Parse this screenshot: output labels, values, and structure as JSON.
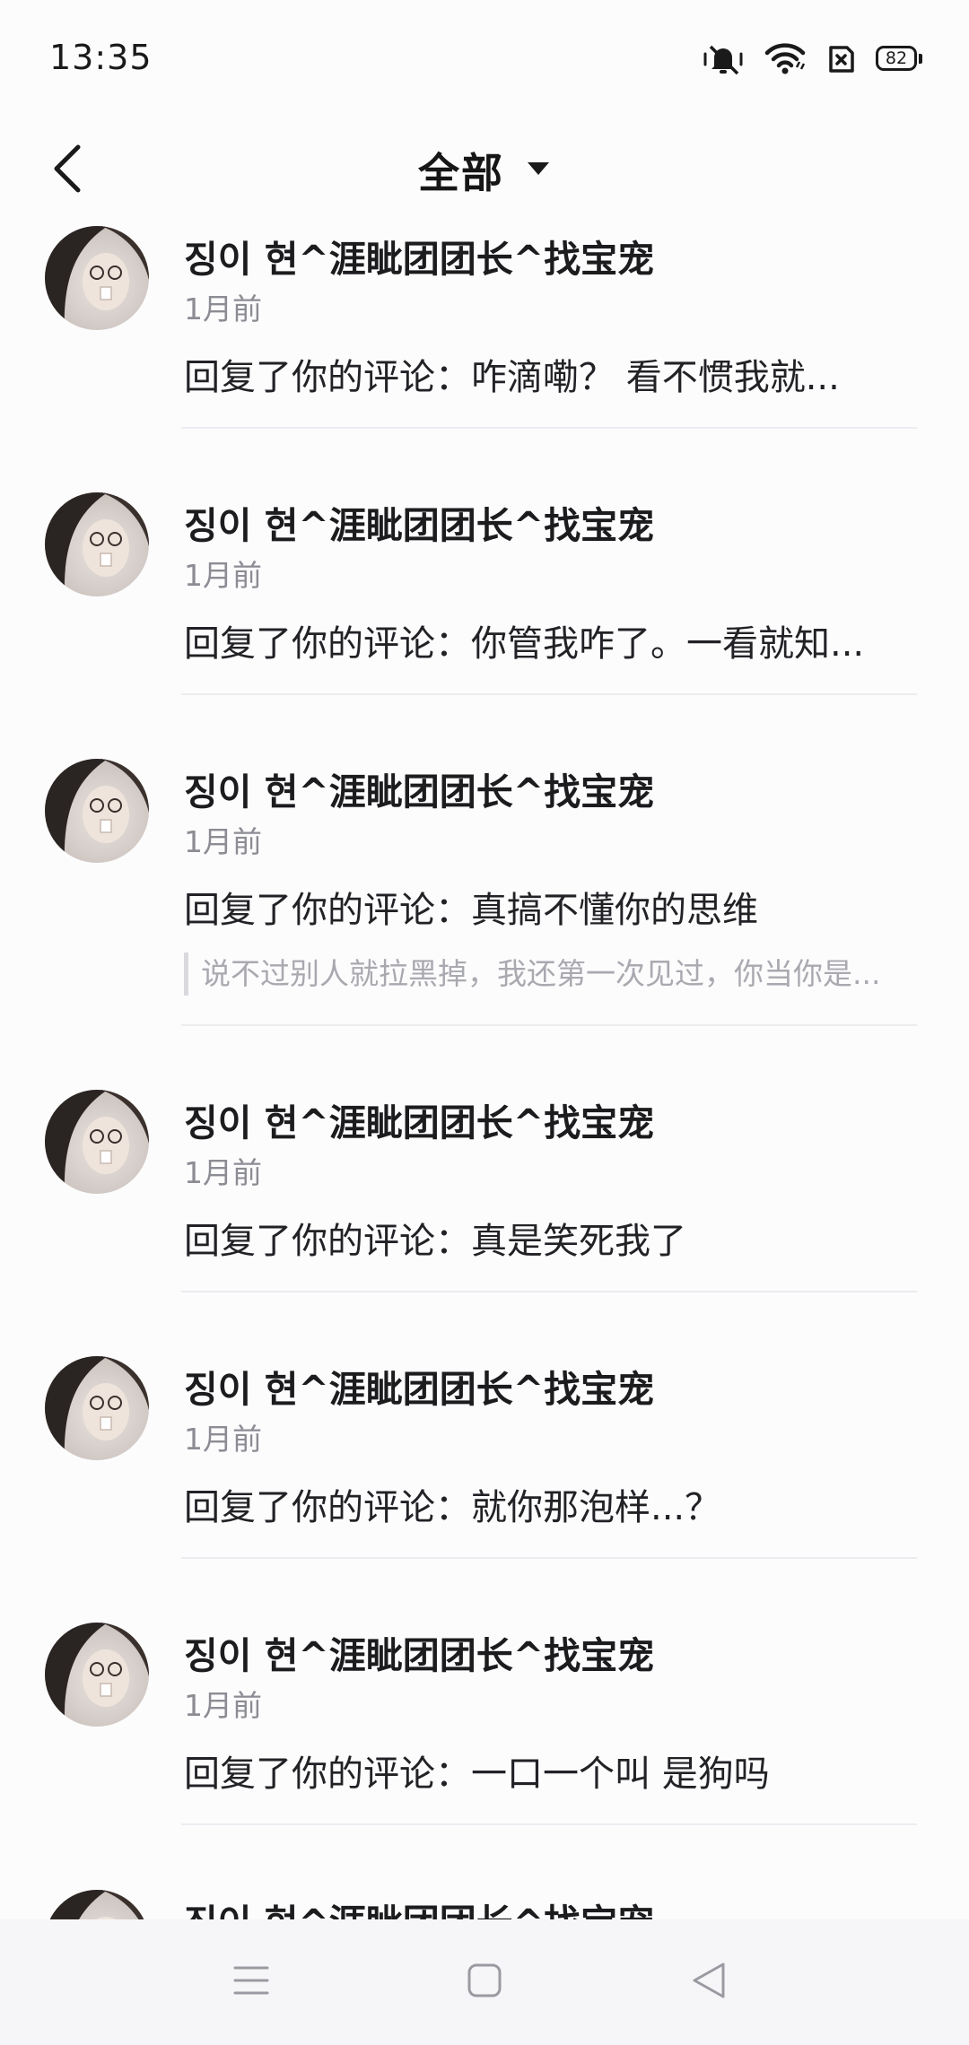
{
  "status_bar": {
    "time": "13:35",
    "battery_level": "82",
    "icons": [
      "mute-vibrate-icon",
      "wifi-icon",
      "sim-off-icon",
      "battery-icon"
    ]
  },
  "header": {
    "title": "全部",
    "back_icon": "chevron-left-icon",
    "dropdown_icon": "caret-down-icon"
  },
  "notifications": [
    {
      "username": "징이 현^涯眦团团长^找宝宠",
      "time": "1月前",
      "reply": "回复了你的评论：咋滴嘞？ 看不惯我就..."
    },
    {
      "username": "징이 현^涯眦团团长^找宝宠",
      "time": "1月前",
      "reply": "回复了你的评论：你管我咋了。一看就知..."
    },
    {
      "username": "징이 현^涯眦团团长^找宝宠",
      "time": "1月前",
      "reply": "回复了你的评论：真搞不懂你的思维",
      "quote": "说不过别人就拉黑掉，我还第一次见过，你当你是..."
    },
    {
      "username": "징이 현^涯眦团团长^找宝宠",
      "time": "1月前",
      "reply": "回复了你的评论：真是笑死我了"
    },
    {
      "username": "징이 현^涯眦团团长^找宝宠",
      "time": "1月前",
      "reply": "回复了你的评论：就你那泡样...？"
    },
    {
      "username": "징이 현^涯眦团团长^找宝宠",
      "time": "1月前",
      "reply": "回复了你的评论：一口一个叫 是狗吗"
    },
    {
      "username": "징이 현^涯眦团团长^找宝宠"
    }
  ],
  "nav_bar": {
    "icons": [
      "menu-icon",
      "home-square-icon",
      "back-triangle-icon"
    ]
  }
}
